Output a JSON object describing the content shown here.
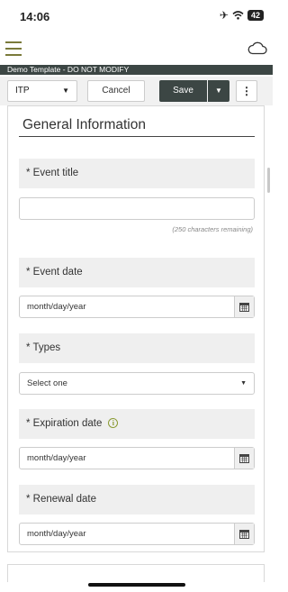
{
  "status": {
    "time": "14:06",
    "battery": "42"
  },
  "app": {
    "template_title": "Demo Template - DO NOT MODIFY"
  },
  "toolbar": {
    "itp_select": "ITP",
    "cancel_label": "Cancel",
    "save_label": "Save",
    "more_label": "⋮"
  },
  "form": {
    "section_title": "General Information",
    "fields": [
      {
        "label": "* Event title",
        "value": "",
        "helper": "(250 characters remaining)"
      },
      {
        "label": "* Event date",
        "placeholder": "month/day/year"
      },
      {
        "label": "* Types",
        "value": "Select one"
      },
      {
        "label": "* Expiration date",
        "placeholder": "month/day/year"
      },
      {
        "label": "* Renewal date",
        "placeholder": "month/day/year"
      }
    ]
  },
  "icons": {
    "menu": "hamburger-icon",
    "sync": "cloud-icon",
    "calendar": "calendar-icon",
    "info": "info-icon"
  },
  "colors": {
    "header_dark": "#3c4644",
    "accent_olive": "#7a7a3a",
    "label_bg": "#efefef"
  }
}
